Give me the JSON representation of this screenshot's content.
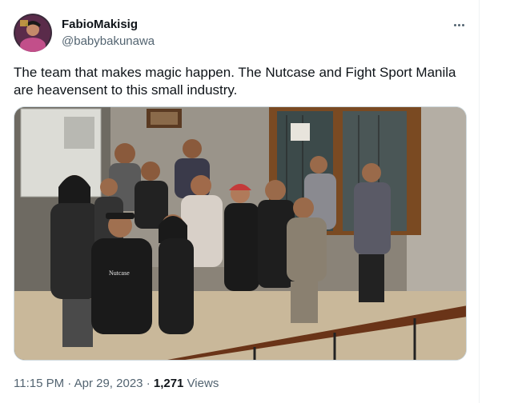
{
  "author": {
    "display_name": "FabioMakisig",
    "handle": "@babybakunawa",
    "avatar_icon": "profile-avatar"
  },
  "tweet": {
    "text": "The team that makes magic happen. The Nutcase and Fight Sport Manila are heavensent to this small industry.",
    "media": {
      "type": "photo",
      "shirt_text": "Nutcase"
    }
  },
  "more_icon": "more-options-icon",
  "meta": {
    "time": "11:15 PM",
    "separator": "·",
    "date": "Apr 29, 2023",
    "separator2": "·",
    "views_count": "1,271",
    "views_label": "Views"
  },
  "colors": {
    "text": "#0f1419",
    "secondary": "#536471",
    "border": "#cfd9de"
  }
}
